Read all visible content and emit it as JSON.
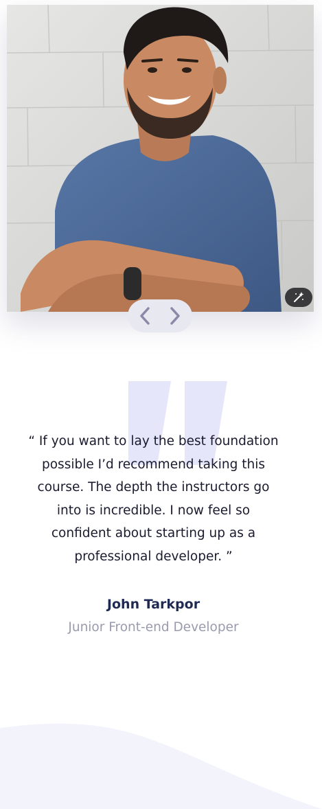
{
  "photo": {
    "description_icon": "portrait-photo",
    "magic_icon": "magic-wand-icon"
  },
  "slider": {
    "prev_icon": "chevron-left-icon",
    "next_icon": "chevron-right-icon"
  },
  "testimonial": {
    "quote": "“ If you want to lay the best foundation possible I’d recommend taking this course. The depth the instructors go into is incredible. I now feel so confident about starting up as a professional developer. ”",
    "author_name": "John Tarkpor",
    "author_role": "Junior Front-end Developer"
  },
  "colors": {
    "author_name": "#1f2a52",
    "author_role": "#9a9aae",
    "quote_mark": "#e6e6fa",
    "nav_background": "#e8e8f0",
    "nav_chevron": "#8a8aa8",
    "wave": "#f3f3fc"
  }
}
